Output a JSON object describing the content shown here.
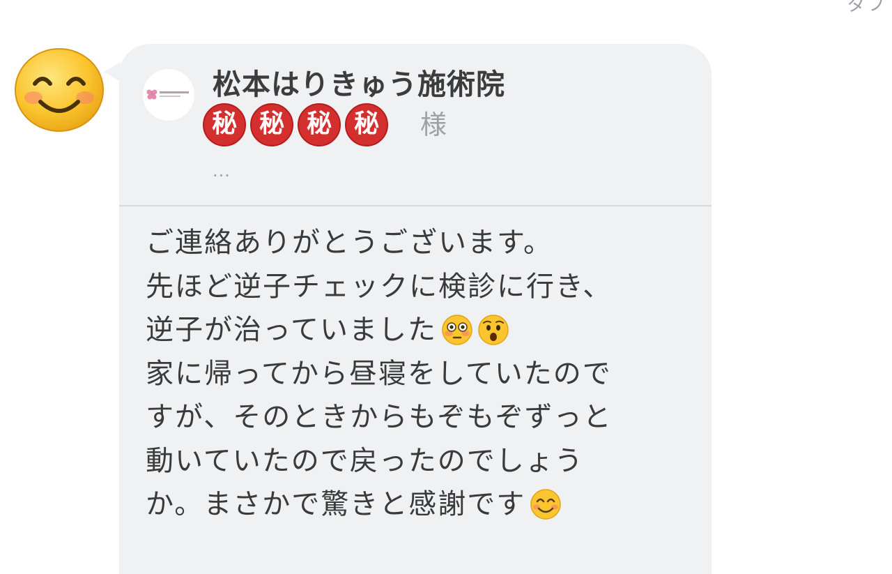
{
  "corner_glyph": "ダフ",
  "sender": {
    "avatar_icon": "smiling-face-icon"
  },
  "card": {
    "logo_icon": "clinic-logo-icon",
    "clinic_name": "松本はりきゅう施術院",
    "recipient_badges": [
      "秘",
      "秘",
      "秘",
      "秘"
    ],
    "recipient_badge_color": "#d32f2f",
    "recipient_honorific": "様",
    "more_dots": "..."
  },
  "message": {
    "lines": [
      {
        "text": "ご連絡ありがとうございます。",
        "emojis": []
      },
      {
        "text": "先ほど逆子チェックに検診に行き、",
        "emojis": []
      },
      {
        "text": "逆子が治っていました",
        "emojis": [
          "flushed-face-icon",
          "astonished-face-icon"
        ]
      },
      {
        "text": "家に帰ってから昼寝をしていたので",
        "emojis": []
      },
      {
        "text": "すが、そのときからもぞもぞずっと",
        "emojis": []
      },
      {
        "text": "動いていたので戻ったのでしょう",
        "emojis": []
      },
      {
        "text": "か。まさかで驚きと感謝です",
        "emojis": [
          "smiling-face-icon"
        ]
      }
    ]
  },
  "colors": {
    "bubble_bg": "#f0f1f3",
    "text_primary": "#3a3a3a",
    "text_secondary": "#9ea2a6",
    "divider": "#d6d8db"
  }
}
